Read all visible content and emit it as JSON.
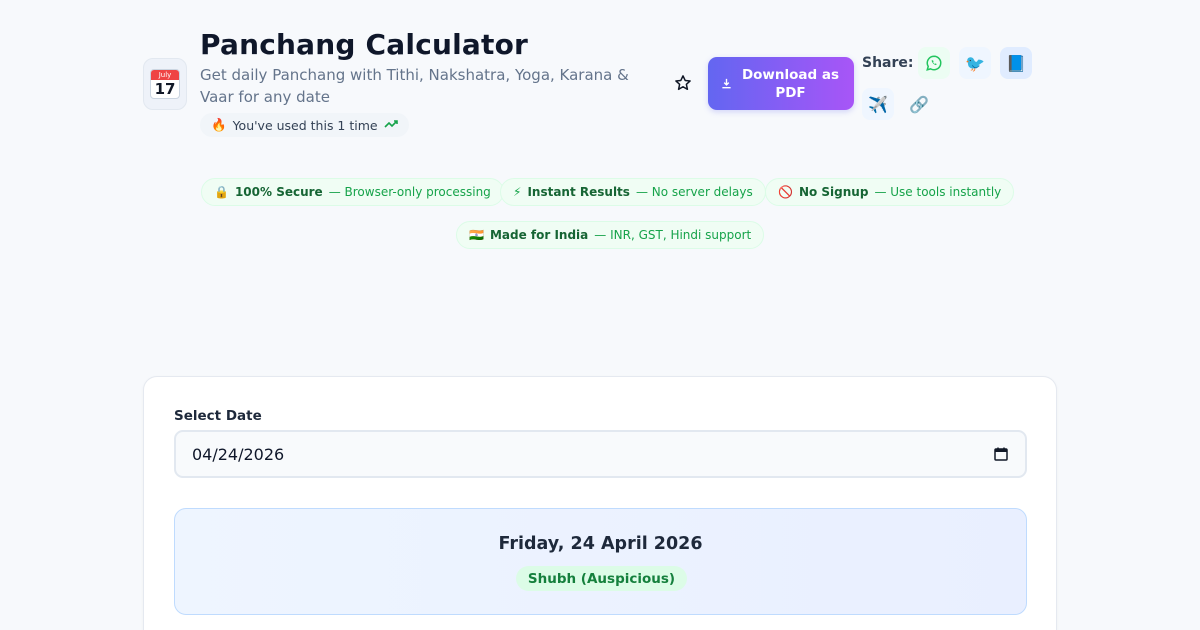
{
  "header": {
    "app_icon": {
      "name": "calendar-icon",
      "month": "July",
      "day": "17"
    },
    "title": "Panchang Calculator",
    "subtitle": "Get daily Panchang with Tithi, Nakshatra, Yoga, Karana & Vaar for any date",
    "usage": {
      "icon": "🔥",
      "text": "You've used this 1 time"
    },
    "download_label": "Download as PDF",
    "share_label": "Share:",
    "share_icons": {
      "whatsapp": "◎",
      "twitter": "🐦",
      "facebook": "📘",
      "telegram": "✈️",
      "link": "🔗"
    }
  },
  "badges": [
    {
      "icon": "🔒",
      "title": "100% Secure",
      "desc": "— Browser-only processing"
    },
    {
      "icon": "⚡",
      "title": "Instant Results",
      "desc": "— No server delays"
    },
    {
      "icon": "🚫",
      "title": "No Signup",
      "desc": "— Use tools instantly"
    },
    {
      "icon": "🇮🇳",
      "title": "Made for India",
      "desc": "— INR, GST, Hindi support"
    }
  ],
  "form": {
    "date_label": "Select Date",
    "date_value": "04/24/2026"
  },
  "result": {
    "date_text": "Friday, 24 April 2026",
    "status": "Shubh (Auspicious)"
  },
  "colors": {
    "accent_start": "#6366f1",
    "accent_end": "#a855f7",
    "success": "#16a34a",
    "background": "#f7f9fc"
  }
}
